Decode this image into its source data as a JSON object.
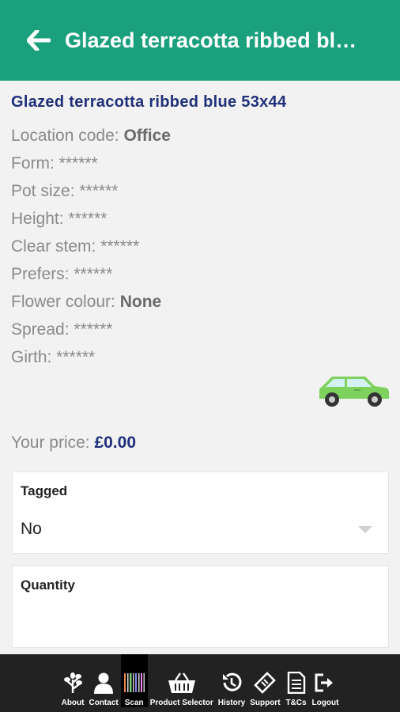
{
  "header": {
    "title": "Glazed terracotta ribbed bl…"
  },
  "product": {
    "title": "Glazed terracotta ribbed blue 53x44",
    "attributes": [
      {
        "label": "Location code: ",
        "value": "Office"
      },
      {
        "label": "Form: ",
        "value": "******"
      },
      {
        "label": "Pot size: ",
        "value": "******"
      },
      {
        "label": "Height: ",
        "value": "******"
      },
      {
        "label": "Clear stem: ",
        "value": "******"
      },
      {
        "label": "Prefers: ",
        "value": "******"
      },
      {
        "label": "Flower colour: ",
        "value": "None"
      },
      {
        "label": "Spread: ",
        "value": "******"
      },
      {
        "label": "Girth: ",
        "value": "******"
      }
    ],
    "price_label": "Your price: ",
    "price_value": "£0.00"
  },
  "tagged": {
    "label": "Tagged",
    "value": "No"
  },
  "quantity": {
    "label": "Quantity",
    "value": ""
  },
  "nav": [
    {
      "label": "About",
      "icon": "leaf-icon"
    },
    {
      "label": "Contact",
      "icon": "person-icon"
    },
    {
      "label": "Scan",
      "icon": "barcode-icon"
    },
    {
      "label": "Product Selector",
      "icon": "basket-icon"
    },
    {
      "label": "History",
      "icon": "history-icon"
    },
    {
      "label": "Support",
      "icon": "ticket-icon"
    },
    {
      "label": "T&Cs",
      "icon": "document-icon"
    },
    {
      "label": "Logout",
      "icon": "logout-icon"
    }
  ],
  "colors": {
    "header": "#1ba07e",
    "title": "#1f2f7a",
    "car": "#7dd15c",
    "bottombar": "#222222"
  }
}
